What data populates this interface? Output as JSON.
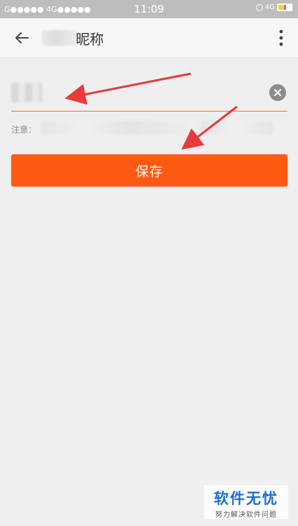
{
  "status_bar": {
    "left_text": "G●●●●● 4G●●●●●",
    "time": "11:09",
    "network": "4G"
  },
  "app_bar": {
    "title": "昵称"
  },
  "form": {
    "nickname_value": "",
    "note_label": "注意："
  },
  "actions": {
    "save_label": "保存"
  },
  "colors": {
    "accent": "#ff5a14",
    "underline": "#f26b2a",
    "arrow": "#e8393b"
  },
  "watermark": {
    "main": "软件无忧",
    "sub": "努力解决软件问题"
  }
}
